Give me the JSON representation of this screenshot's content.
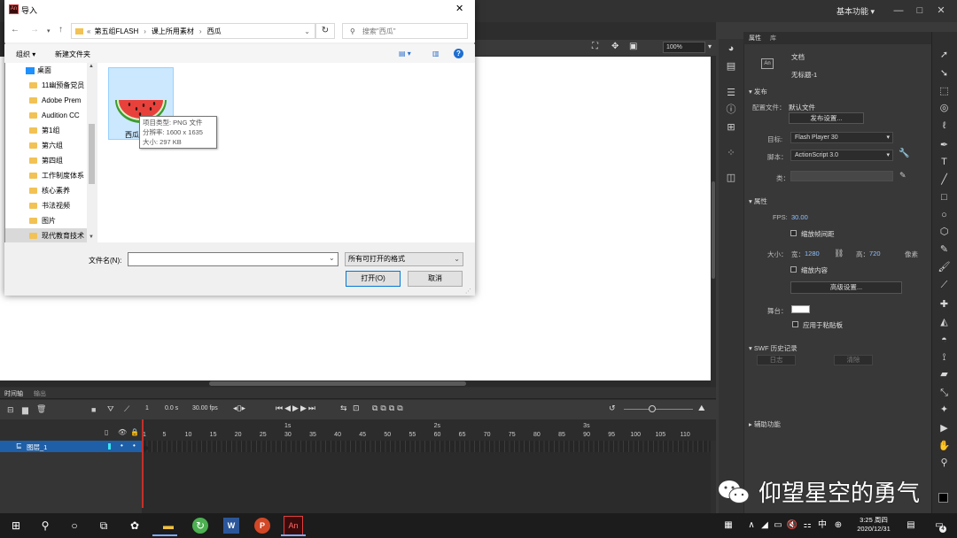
{
  "app": {
    "workspace": "基本功能",
    "window_controls": [
      "—",
      "□",
      "✕"
    ]
  },
  "stage_toolbar": {
    "zoom": "100%"
  },
  "properties_panel": {
    "tabs": [
      "属性",
      "库"
    ],
    "doc_type": "文档",
    "doc_name": "无标题-1",
    "publish_section": "发布",
    "profile_label": "配置文件：",
    "profile_value": "默认文件",
    "publish_settings_btn": "发布设置...",
    "target_label": "目标:",
    "target_value": "Flash Player 30",
    "script_label": "脚本：",
    "script_value": "ActionScript 3.0",
    "class_label": "类：",
    "props_section": "属性",
    "fps_label": "FPS:",
    "fps_value": "30.00",
    "scale_spans": "缩放帧间距",
    "size_label": "大小：",
    "width_label": "宽：",
    "width_value": "1280",
    "height_label": "高：",
    "height_value": "720",
    "units": "像素",
    "scale_content": "缩放内容",
    "advanced_btn": "高级设置...",
    "stage_label": "舞台：",
    "stage_color": "#ffffff",
    "apply_pasteboard": "应用于粘贴板",
    "swf_history": "SWF 历史记录",
    "log_btn": "日志",
    "clear_btn": "清除",
    "accessibility": "辅助功能"
  },
  "timeline": {
    "tabs": [
      "时间轴",
      "输出"
    ],
    "frame_num": "1",
    "time": "0.0 s",
    "fps": "30.00 fps",
    "layer_name": "图层_1",
    "seconds_labels": [
      "1s",
      "2s",
      "3s"
    ],
    "frame_ticks": [
      "1",
      "5",
      "10",
      "15",
      "20",
      "25",
      "30",
      "35",
      "40",
      "45",
      "50",
      "55",
      "60",
      "65",
      "70",
      "75",
      "80",
      "85",
      "90",
      "95",
      "100",
      "105",
      "110"
    ]
  },
  "dialog": {
    "title": "导入",
    "breadcrumb": [
      "第五组FLASH",
      "课上所用素材",
      "西瓜"
    ],
    "search_placeholder": "搜索\"西瓜\"",
    "organize": "组织 ▾",
    "new_folder": "新建文件夹",
    "tree": [
      "桌面",
      "11幽预备党员",
      "Adobe Prem",
      "Audition CC",
      "第1组",
      "第六组",
      "第四组",
      "工作制度体系",
      "核心素养",
      "书法视频",
      "图片",
      "现代教育技术"
    ],
    "file_name": "西瓜",
    "tooltip": [
      "项目类型: PNG 文件",
      "分辨率: 1600 x 1635",
      "大小: 297 KB"
    ],
    "filename_label": "文件名(N):",
    "filename_value": "",
    "filetype": "所有可打开的格式",
    "open_btn": "打开(O)",
    "cancel_btn": "取消"
  },
  "taskbar": {
    "time": "3:25 周四",
    "date": "2020/12/31",
    "ime": "中",
    "notification_count": "4"
  },
  "watermark": "仰望星空的勇气",
  "colors": {
    "accent": "#1f5fa7",
    "playhead": "#c4302b",
    "dialog_selection": "#cce8ff"
  }
}
